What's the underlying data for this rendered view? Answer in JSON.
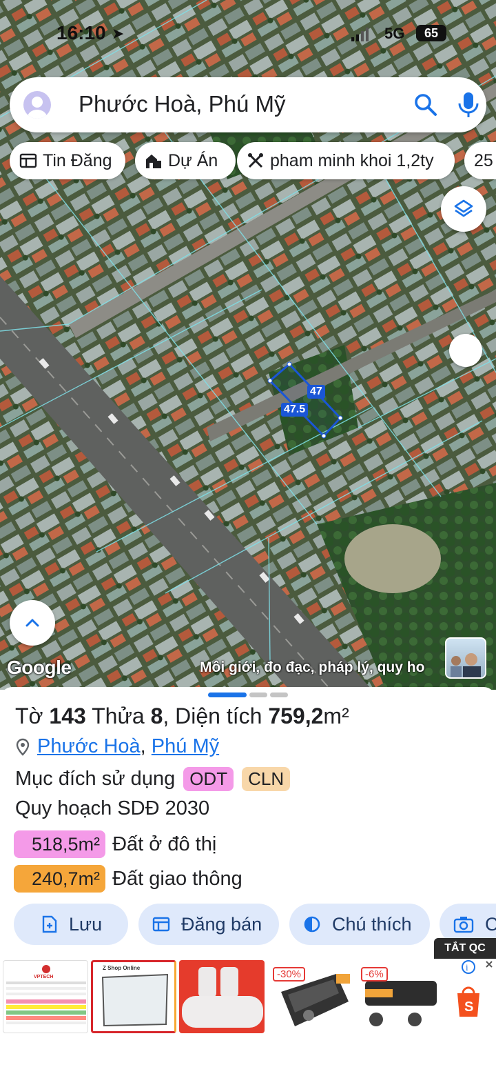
{
  "status_bar": {
    "time": "16:10",
    "network": "5G",
    "battery": "65"
  },
  "search": {
    "query": "Phước Hoà, Phú Mỹ"
  },
  "chips": [
    {
      "label": "Tin Đăng",
      "icon": "news-icon"
    },
    {
      "label": "Dự Án",
      "icon": "building-icon"
    },
    {
      "label": "pham minh khoi 1,2ty",
      "icon": "tools-icon"
    },
    {
      "label": "25",
      "icon": ""
    }
  ],
  "map": {
    "measurements": [
      "47",
      "47.5"
    ],
    "attribution": "Google",
    "credit": "Môi giới, đo đạc, pháp lý, quy ho",
    "colors": {
      "parcel_outline": "#1a56d6",
      "cadastral_lines": "#7fe0e8"
    }
  },
  "sheet": {
    "title": {
      "to_label": "Tờ",
      "to_value": "143",
      "thua_label": "Thửa",
      "thua_value": "8",
      "area_label": "Diện tích",
      "area_value": "759,2",
      "area_unit": "m²"
    },
    "place": {
      "ward": "Phước Hoà",
      "separator": ",",
      "town": "Phú Mỹ"
    },
    "usage": {
      "label": "Mục đích sử dụng",
      "tags": [
        {
          "code": "ODT",
          "color": "#f49ae8"
        },
        {
          "code": "CLN",
          "color": "#f8d7a9"
        }
      ]
    },
    "plan_label": "Quy hoạch SDĐ 2030",
    "zones": [
      {
        "area": "518,5m²",
        "name": "Đất ở đô thị",
        "color": "#f49ae8"
      },
      {
        "area": "240,7m²",
        "name": "Đất giao thông",
        "color": "#f5a63a"
      }
    ],
    "actions": [
      {
        "label": "Lưu",
        "icon": "save-icon"
      },
      {
        "label": "Đăng bán",
        "icon": "list-icon"
      },
      {
        "label": "Chú thích",
        "icon": "contrast-icon"
      },
      {
        "label": "C",
        "icon": "camera-icon"
      }
    ],
    "ads_toggle": "TẮT QC",
    "ads": [
      {
        "label": "VPTECH",
        "badge": ""
      },
      {
        "label": "Z Shop Online",
        "badge": ""
      },
      {
        "label": "",
        "badge": ""
      },
      {
        "label": "",
        "badge": "-30%"
      },
      {
        "label": "",
        "badge": "-6%"
      }
    ]
  }
}
